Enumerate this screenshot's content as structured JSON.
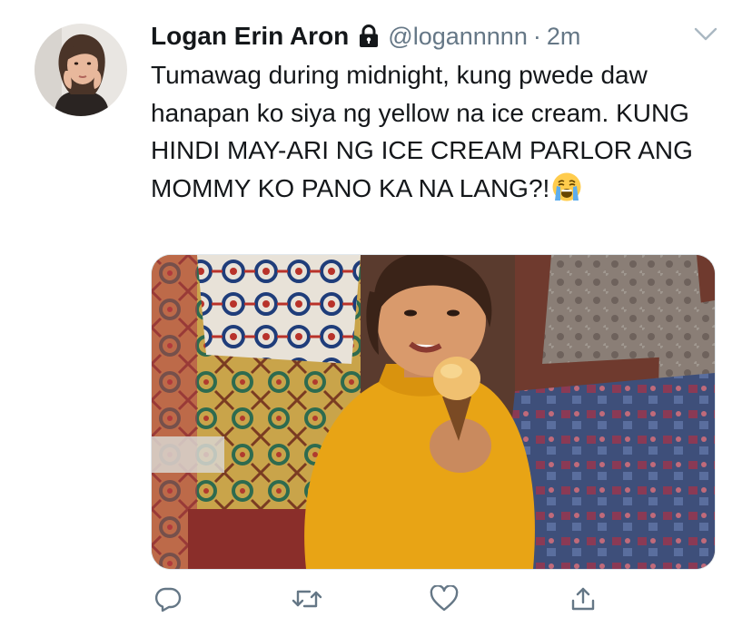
{
  "tweet": {
    "author_name": "Logan Erin Aron",
    "protected_icon": "lock-icon",
    "handle": "@logannnnn",
    "separator": "·",
    "timestamp": "2m",
    "menu_icon": "chevron-down-icon",
    "text": "Tumawag during midnight, kung pwede daw hanapan ko siya ng yellow na ice cream. KUNG HINDI MAY-ARI NG ICE CREAM PARLOR ANG MOMMY KO PANO KA NA LANG?!",
    "emoji": "loudly-crying-face-emoji",
    "media": "photo-woman-yellow-sweater-ice-cream-cone"
  },
  "actions": [
    {
      "icon": "reply-icon"
    },
    {
      "icon": "retweet-icon"
    },
    {
      "icon": "like-icon"
    },
    {
      "icon": "share-icon"
    }
  ],
  "colors": {
    "text": "#14171a",
    "secondary": "#657786",
    "icon": "#657786",
    "background": "#ffffff"
  }
}
